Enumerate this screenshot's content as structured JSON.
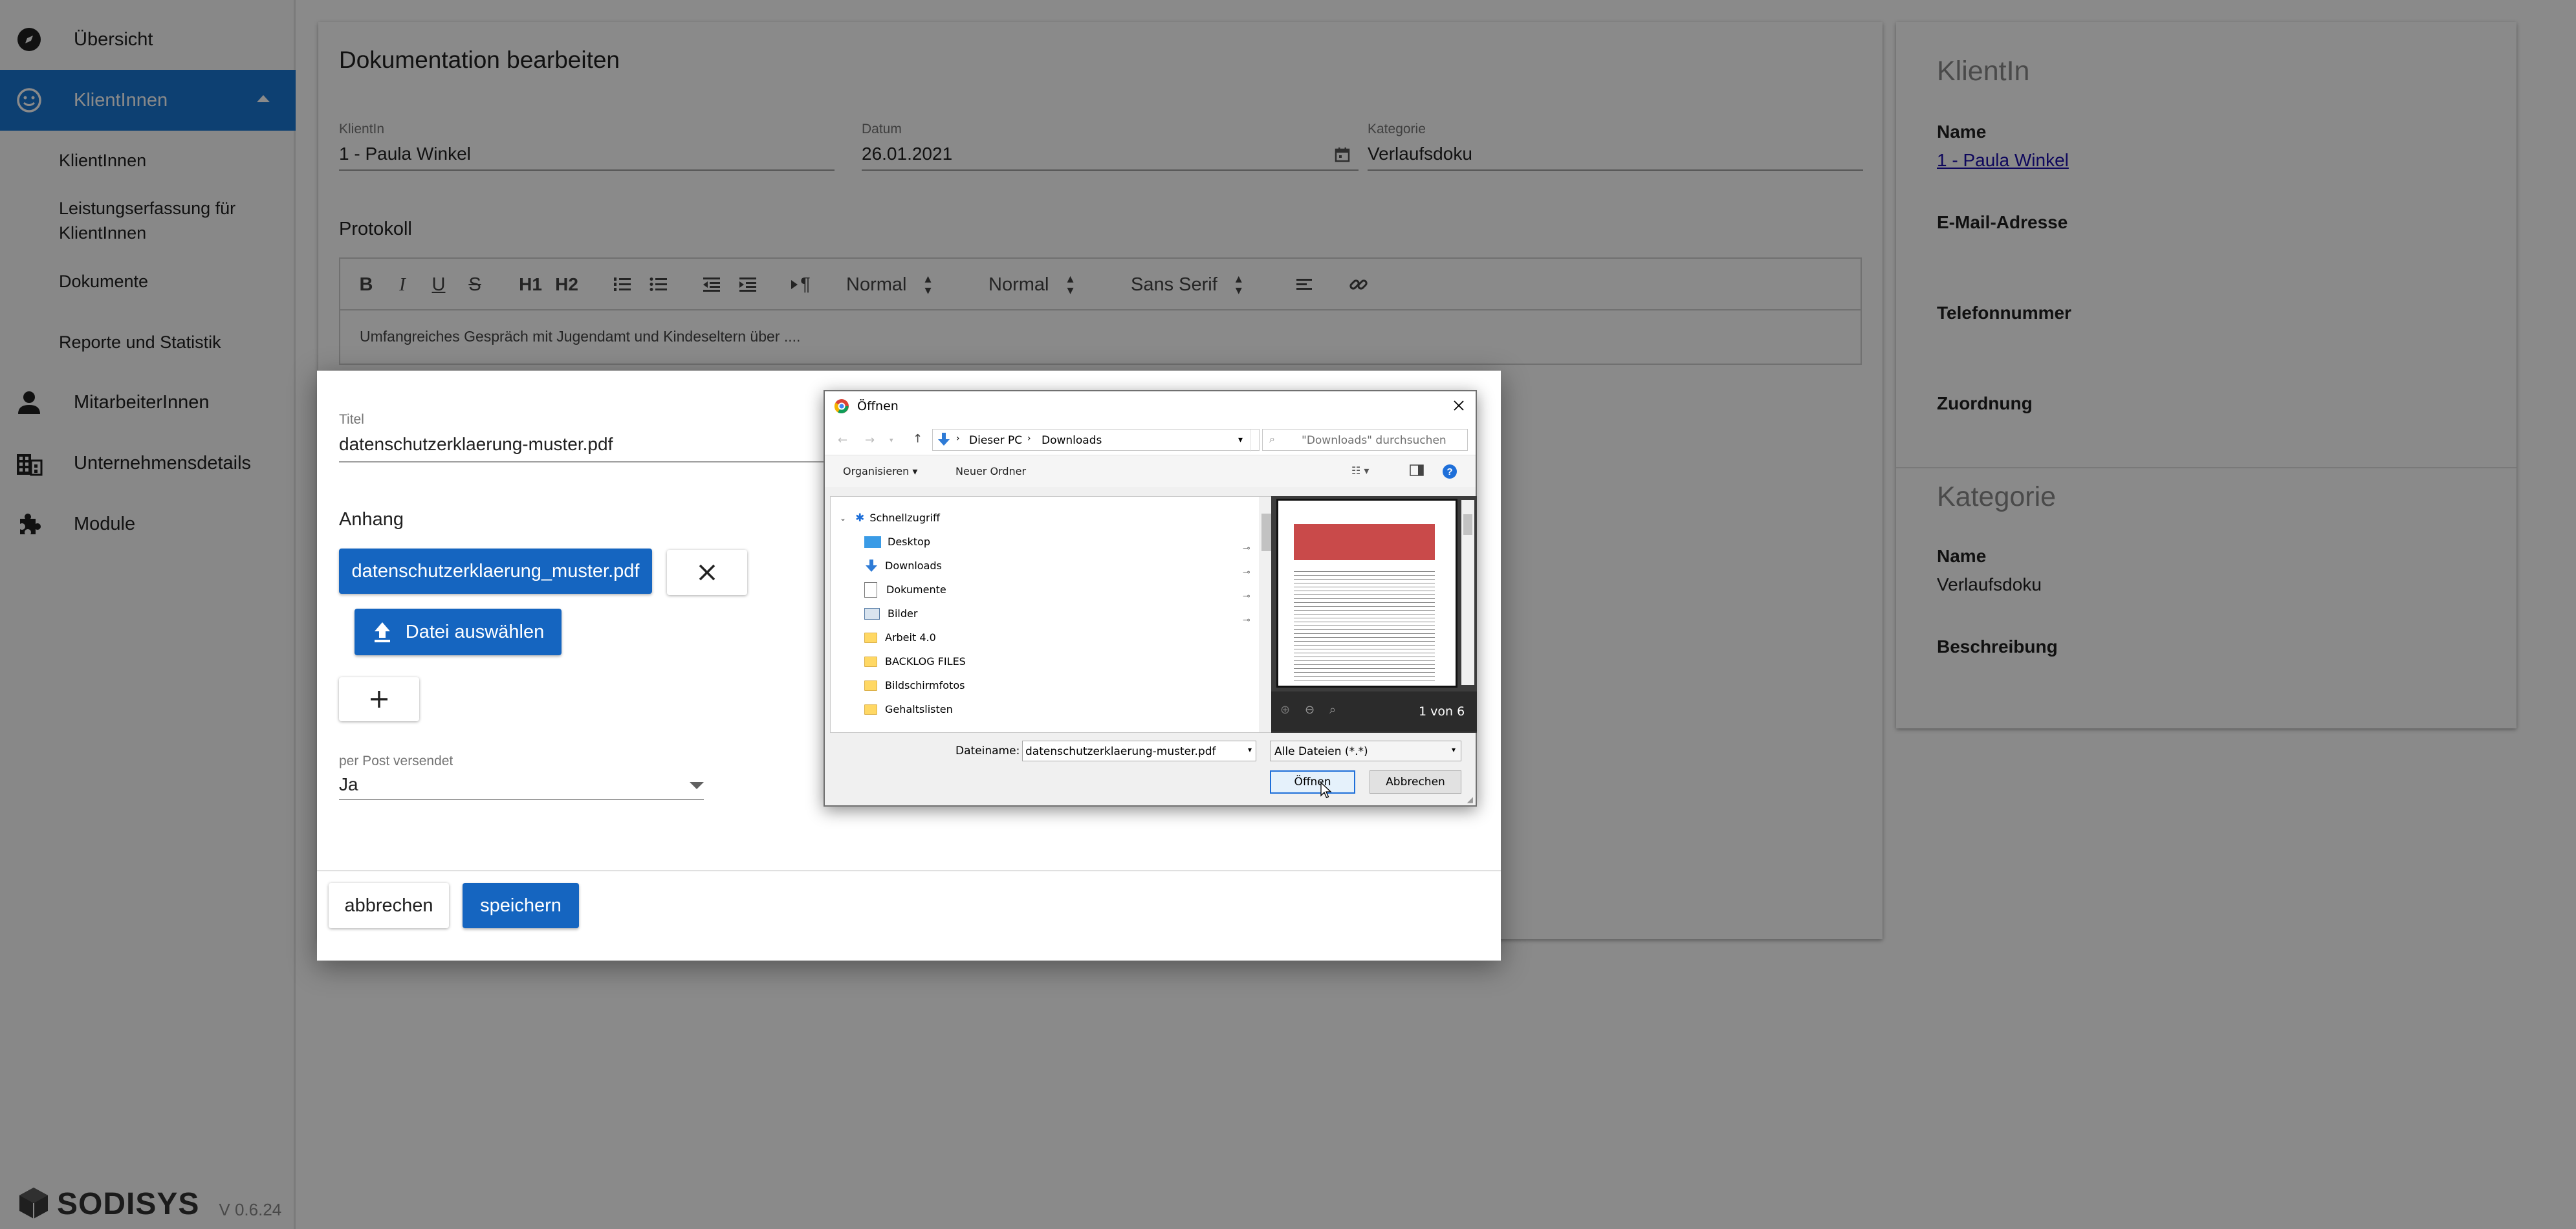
{
  "app": {
    "logo": "SODISYS",
    "version": "V 0.6.24"
  },
  "sidebar": {
    "overview": "Übersicht",
    "clients": "KlientInnen",
    "sub": {
      "clients": "KlientInnen",
      "services_line1": "Leistungserfassung für",
      "services_line2": "KlientInnen",
      "documents": "Dokumente",
      "reports": "Reporte und Statistik"
    },
    "employees": "MitarbeiterInnen",
    "company": "Unternehmensdetails",
    "modules": "Module"
  },
  "main": {
    "title": "Dokumentation bearbeiten",
    "client_label": "KlientIn",
    "client_value": "1 - Paula Winkel",
    "date_label": "Datum",
    "date_value": "26.01.2021",
    "category_label": "Kategorie",
    "category_value": "Verlaufsdoku",
    "protocol_label": "Protokoll",
    "toolbar": {
      "h1": "H1",
      "h2": "H2",
      "paragraph": "¶",
      "size": "Normal",
      "heading": "Normal",
      "font": "Sans Serif"
    },
    "editor_text": "Umfangreiches Gespräch mit Jugendamt und Kindeseltern über ...."
  },
  "right": {
    "client_heading": "KlientIn",
    "name_label": "Name",
    "name_value": "1 - Paula Winkel",
    "email_label": "E-Mail-Adresse",
    "phone_label": "Telefonnummer",
    "assignment_label": "Zuordnung",
    "category_heading": "Kategorie",
    "cat_name_label": "Name",
    "cat_name_value": "Verlaufsdoku",
    "description_label": "Beschreibung"
  },
  "modal": {
    "title_label": "Titel",
    "title_value": "datenschutzerklaerung-muster.pdf",
    "attachment_label": "Anhang",
    "file_chip": "datenschutzerklaerung_muster.pdf",
    "choose_file": "Datei auswählen",
    "post_label": "per Post versendet",
    "post_value": "Ja",
    "cancel": "abbrechen",
    "save": "speichern"
  },
  "file_dialog": {
    "title": "Öffnen",
    "path_pc": "Dieser PC",
    "path_folder": "Downloads",
    "search_placeholder": "\"Downloads\" durchsuchen",
    "organize": "Organisieren",
    "new_folder": "Neuer Ordner",
    "quick_access": "Schnellzugriff",
    "tree": [
      "Desktop",
      "Downloads",
      "Dokumente",
      "Bilder",
      "Arbeit 4.0",
      "BACKLOG FILES",
      "Bildschirmfotos",
      "Gehaltslisten"
    ],
    "page_info": "1 von 6",
    "filename_label": "Dateiname:",
    "filename_value": "datenschutzerklaerung-muster.pdf",
    "filter": "Alle Dateien (*.*)",
    "open": "Öffnen",
    "cancel": "Abbrechen"
  },
  "colors": {
    "accent": "#1976d2",
    "primary_button": "#1565c0"
  }
}
